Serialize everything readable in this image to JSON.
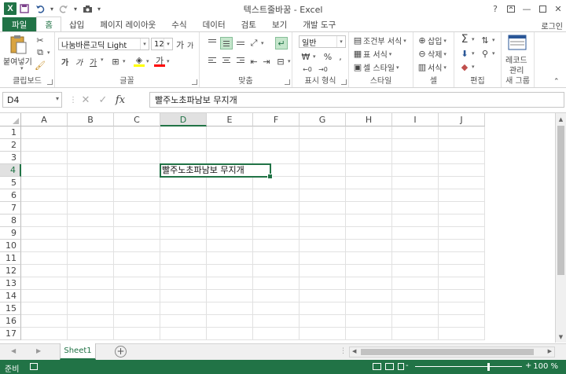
{
  "window": {
    "title": "텍스트줄바꿈 - Excel",
    "signin": "로그인"
  },
  "ribbon_tabs": [
    "파일",
    "홈",
    "삽입",
    "페이지 레이아웃",
    "수식",
    "데이터",
    "검토",
    "보기",
    "개발 도구"
  ],
  "active_tab": "홈",
  "ribbon": {
    "clipboard": {
      "paste": "붙여넣기",
      "label": "클립보드"
    },
    "font": {
      "name": "나눔바른고딕 Light",
      "size": "12",
      "label": "글꼴",
      "grow": "가",
      "shrink": "가",
      "bold": "가",
      "italic": "가",
      "underline": "가",
      "fontcolor": "가"
    },
    "alignment": {
      "label": "맞춤"
    },
    "number": {
      "format": "일반",
      "label": "표시 형식"
    },
    "styles": {
      "conditional": "조건부 서식",
      "table": "표 서식",
      "cell": "셀 스타일",
      "label": "스타일"
    },
    "cells": {
      "insert": "삽입",
      "delete": "삭제",
      "format": "서식",
      "label": "셀"
    },
    "editing": {
      "label": "편집"
    },
    "new_group": {
      "manage1": "레코드",
      "manage2": "관리",
      "label": "새 그룹"
    }
  },
  "formula_bar": {
    "name_box": "D4",
    "fx": "fx",
    "content": "빨주노초파남보 무지개"
  },
  "grid": {
    "columns": [
      "A",
      "B",
      "C",
      "D",
      "E",
      "F",
      "G",
      "H",
      "I",
      "J"
    ],
    "selected_column": "D",
    "rows": [
      "1",
      "2",
      "3",
      "4",
      "5",
      "6",
      "7",
      "8",
      "9",
      "10",
      "11",
      "12",
      "13",
      "14",
      "15",
      "16",
      "17"
    ],
    "selected_row": "4",
    "active_cell_value": "빨주노초파남보 무지개"
  },
  "sheets": [
    "Sheet1"
  ],
  "status": {
    "mode": "준비",
    "zoom": "100 %",
    "zoom_minus": "-",
    "zoom_plus": "+"
  },
  "colors": {
    "accent": "#217346",
    "selected_header": "#e1e1e1"
  }
}
